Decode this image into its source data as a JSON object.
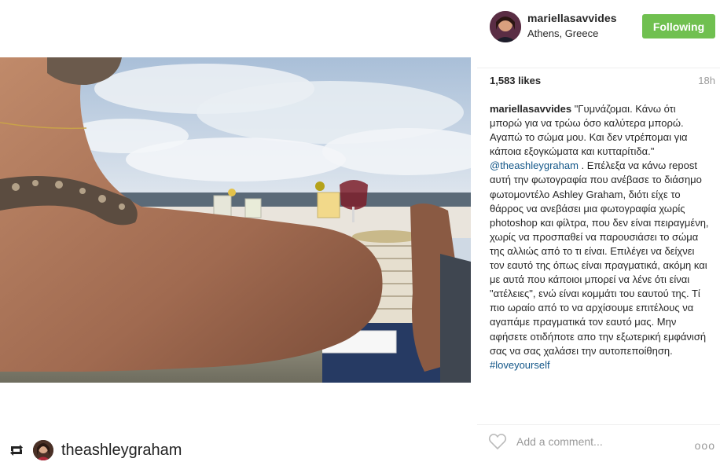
{
  "post": {
    "username": "mariellasavvides",
    "location": "Athens, Greece",
    "follow_label": "Following",
    "likes": "1,583 likes",
    "time": "18h",
    "caption": {
      "user": "mariellasavvides",
      "text_1": " \"Γυμνάζομαι. Κάνω ότι μπορώ για να τρώω όσο καλύτερα μπορώ. Αγαπώ το σώμα μου. Και δεν ντρέπομαι για κάποια εξογκώματα και κυτταρίτιδα.\" ",
      "mention": "@theashleygraham",
      "text_2": " . Επέλεξα να κάνω repost αυτή την φωτογραφία που ανέβασε το διάσημο φωτομοντέλο Ashley Graham, διότι είχε το θάρρος να ανεβάσει μια φωτογραφία χωρίς photoshop και φίλτρα, που δεν είναι πειραγμένη, χωρίς να προσπαθεί να παρουσιάσει το σώμα της αλλιώς από το τι είναι. Επιλέγει να δείχνει τον εαυτό της όπως είναι πραγματικά, ακόμη και με αυτά που κάποιοι μπορεί να λένε ότι είναι \"ατέλειες\", ενώ είναι κομμάτι του εαυτού της. Τί πιο ωραίο από το να αρχίσουμε επιτέλους να αγαπάμε πραγματικά τον εαυτό μας. Μην αφήσετε οτιδήποτε απο την εξωτερική εμφάνισή σας να σας χαλάσει την αυτοπεποίθηση. ",
      "hashtag": "#loveyourself"
    },
    "comment_placeholder": "Add a comment...",
    "more_label": "ooo",
    "icons": {
      "heart": "heart-outline-icon",
      "more": "more-options-icon",
      "repost": "repost-icon"
    }
  },
  "repost_credit": {
    "username": "theashleygraham"
  },
  "colors": {
    "follow_button": "#70c050",
    "link": "#125688",
    "muted": "#999999"
  }
}
